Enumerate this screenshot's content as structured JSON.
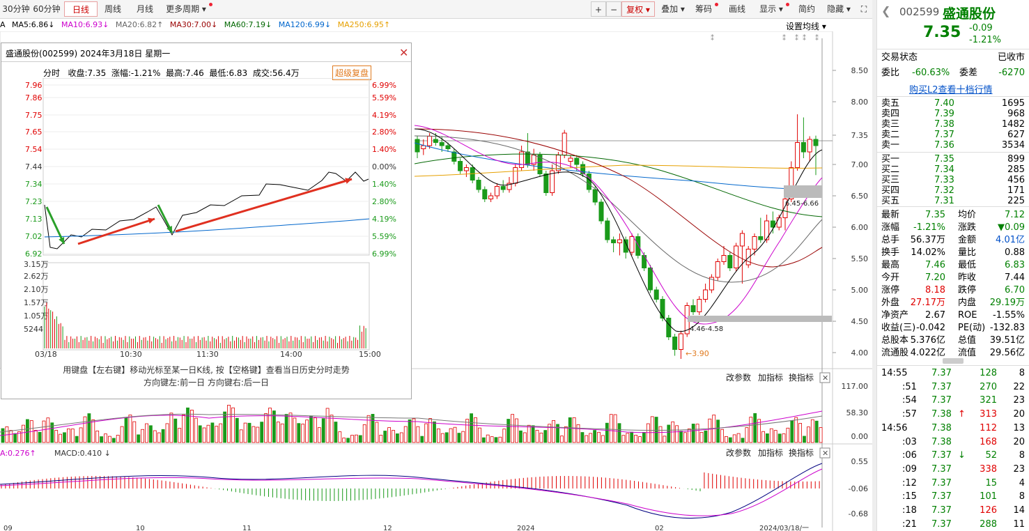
{
  "toolbar": {
    "periods": [
      "30分钟",
      "60分钟",
      "日线",
      "周线",
      "月线",
      "更多周期"
    ],
    "right_buttons": [
      "+",
      "−",
      "复权",
      "叠加",
      "筹码",
      "画线",
      "显示",
      "简约",
      "隐藏"
    ]
  },
  "ma_line": {
    "prefix": "A",
    "items": [
      {
        "label": "MA5:6.86",
        "arrow": "↓",
        "color": "#000000"
      },
      {
        "label": "MA10:6.93",
        "arrow": "↓",
        "color": "#cc00cc"
      },
      {
        "label": "MA20:6.82",
        "arrow": "↑",
        "color": "#666666"
      },
      {
        "label": "MA30:7.00",
        "arrow": "↓",
        "color": "#990000"
      },
      {
        "label": "MA60:7.19",
        "arrow": "↓",
        "color": "#006600"
      },
      {
        "label": "MA120:6.99",
        "arrow": "↓",
        "color": "#0066cc"
      },
      {
        "label": "MA250:6.95",
        "arrow": "↑",
        "color": "#e6a000"
      }
    ],
    "setting_label": "设置均线"
  },
  "main_axis": [
    "8.50",
    "8.00",
    "7.35",
    "7.00",
    "6.50",
    "6.00",
    "5.50",
    "5.00",
    "4.50",
    "4.00"
  ],
  "annotations": {
    "high_box": "6.45-6.66",
    "low_box": "4.46-4.58",
    "low_point": "3.90"
  },
  "volume_panel": {
    "buttons": [
      "改参数",
      "加指标",
      "换指标"
    ],
    "axis": [
      "117.00",
      "58.30",
      "0.00"
    ]
  },
  "macd_panel": {
    "label": "A:0.276",
    "macd": "MACD:0.410",
    "buttons": [
      "改参数",
      "加指标",
      "换指标"
    ],
    "axis": [
      "0.55",
      "-0.06",
      "-0.68"
    ]
  },
  "date_axis": [
    "09",
    "10",
    "11",
    "12",
    "2024",
    "02",
    "2024/03/18/一"
  ],
  "popup": {
    "title": "盛通股份(002599)  2024年3月18日  星期一",
    "tab": "分时",
    "close_label": "收盘:7.35",
    "change_label": "涨幅:-1.21%",
    "high_label": "最高:7.46",
    "low_label": "最低:6.83",
    "vol_label": "成交:56.4万",
    "fq_button": "超级复盘",
    "price_axis": [
      "7.96",
      "7.86",
      "7.75",
      "7.65",
      "7.54",
      "7.44",
      "7.34",
      "7.23",
      "7.13",
      "7.02",
      "6.92"
    ],
    "pct_axis": [
      "6.99%",
      "5.59%",
      "4.19%",
      "2.80%",
      "1.40%",
      "0.00%",
      "1.40%",
      "2.80%",
      "4.19%",
      "5.59%",
      "6.99%"
    ],
    "vol_axis": [
      "3.15万",
      "2.62万",
      "2.10万",
      "1.57万",
      "1.05万",
      "5244"
    ],
    "time_axis": [
      "03/18",
      "10:30",
      "11:30",
      "14:00",
      "15:00"
    ],
    "hint1": "用键盘【左右键】移动光标至某一日K线, 按【空格键】查看当日历史分时走势",
    "hint2": "方向键左:前一日    方向键右:后一日"
  },
  "quote": {
    "code": "002599",
    "name": "盛通股份",
    "price": "7.35",
    "change": "-0.09",
    "change_pct": "-1.21%",
    "status_label": "交易状态",
    "status_value": "已收市",
    "weibi_label": "委比",
    "weibi_value": "-60.63%",
    "weicha_label": "委差",
    "weicha_value": "-6270",
    "l2_link": "购买L2查看十档行情",
    "asks": [
      {
        "label": "卖五",
        "price": "7.40",
        "vol": "1695"
      },
      {
        "label": "卖四",
        "price": "7.39",
        "vol": "968"
      },
      {
        "label": "卖三",
        "price": "7.38",
        "vol": "1482"
      },
      {
        "label": "卖二",
        "price": "7.37",
        "vol": "627"
      },
      {
        "label": "卖一",
        "price": "7.36",
        "vol": "3534"
      }
    ],
    "bids": [
      {
        "label": "买一",
        "price": "7.35",
        "vol": "899"
      },
      {
        "label": "买二",
        "price": "7.34",
        "vol": "285"
      },
      {
        "label": "买三",
        "price": "7.33",
        "vol": "456"
      },
      {
        "label": "买四",
        "price": "7.32",
        "vol": "171"
      },
      {
        "label": "买五",
        "price": "7.31",
        "vol": "225"
      }
    ],
    "stats": [
      {
        "l1": "最新",
        "v1": "7.35",
        "c1": "green",
        "l2": "均价",
        "v2": "7.12",
        "c2": "green"
      },
      {
        "l1": "涨幅",
        "v1": "-1.21%",
        "c1": "green",
        "l2": "涨跌",
        "v2": "▼0.09",
        "c2": "green"
      },
      {
        "l1": "总手",
        "v1": "56.37万",
        "c1": "black",
        "l2": "金额",
        "v2": "4.01亿",
        "c2": "blue"
      },
      {
        "l1": "换手",
        "v1": "14.02%",
        "c1": "black",
        "l2": "量比",
        "v2": "0.88",
        "c2": "black"
      },
      {
        "l1": "最高",
        "v1": "7.46",
        "c1": "green",
        "l2": "最低",
        "v2": "6.83",
        "c2": "green"
      },
      {
        "l1": "今开",
        "v1": "7.20",
        "c1": "green",
        "l2": "昨收",
        "v2": "7.44",
        "c2": "black"
      },
      {
        "l1": "涨停",
        "v1": "8.18",
        "c1": "red",
        "l2": "跌停",
        "v2": "6.70",
        "c2": "green"
      },
      {
        "l1": "外盘",
        "v1": "27.17万",
        "c1": "red",
        "l2": "内盘",
        "v2": "29.19万",
        "c2": "green"
      },
      {
        "l1": "净资产",
        "v1": "2.67",
        "c1": "black",
        "l2": "ROE",
        "v2": "-1.55%",
        "c2": "black"
      },
      {
        "l1": "收益(三)",
        "v1": "-0.042",
        "c1": "black",
        "l2": "PE(动)",
        "v2": "-132.83",
        "c2": "black"
      },
      {
        "l1": "总股本",
        "v1": "5.376亿",
        "c1": "black",
        "l2": "总值",
        "v2": "39.51亿",
        "c2": "black"
      },
      {
        "l1": "流通股",
        "v1": "4.022亿",
        "c1": "black",
        "l2": "流值",
        "v2": "29.56亿",
        "c2": "black"
      }
    ],
    "ticks": [
      {
        "t": "14:55",
        "p": "7.37",
        "v": "128",
        "n": "8",
        "vc": "green",
        "ar": ""
      },
      {
        "t": ":51",
        "p": "7.37",
        "v": "270",
        "n": "22",
        "vc": "green",
        "ar": ""
      },
      {
        "t": ":54",
        "p": "7.37",
        "v": "321",
        "n": "23",
        "vc": "green",
        "ar": ""
      },
      {
        "t": ":57",
        "p": "7.38",
        "v": "313",
        "n": "20",
        "vc": "red",
        "ar": "↑"
      },
      {
        "t": "14:56",
        "p": "7.38",
        "v": "112",
        "n": "13",
        "vc": "red",
        "ar": ""
      },
      {
        "t": ":03",
        "p": "7.38",
        "v": "168",
        "n": "20",
        "vc": "red",
        "ar": ""
      },
      {
        "t": ":06",
        "p": "7.37",
        "v": "52",
        "n": "8",
        "vc": "green",
        "ar": "↓"
      },
      {
        "t": ":09",
        "p": "7.37",
        "v": "338",
        "n": "23",
        "vc": "red",
        "ar": ""
      },
      {
        "t": ":12",
        "p": "7.37",
        "v": "15",
        "n": "4",
        "vc": "green",
        "ar": ""
      },
      {
        "t": ":15",
        "p": "7.37",
        "v": "101",
        "n": "8",
        "vc": "green",
        "ar": ""
      },
      {
        "t": ":18",
        "p": "7.37",
        "v": "126",
        "n": "14",
        "vc": "red",
        "ar": ""
      },
      {
        "t": ":21",
        "p": "7.37",
        "v": "288",
        "n": "11",
        "vc": "green",
        "ar": ""
      }
    ]
  }
}
